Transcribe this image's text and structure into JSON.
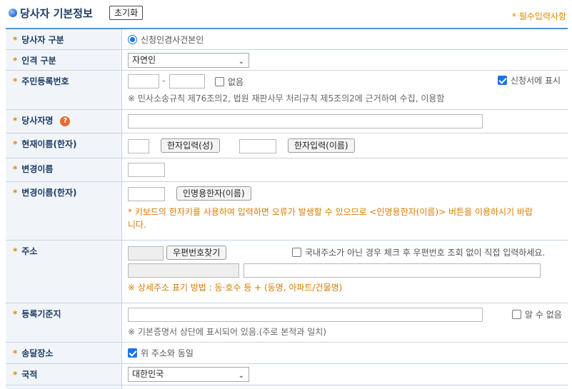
{
  "header": {
    "title": "당사자 기본정보",
    "reset_label": "초기화",
    "required_note": "* 필수입력사항"
  },
  "rows": {
    "party_type": {
      "label": "당사자 구분",
      "radio_label": "신청인겸사건본인"
    },
    "person_type": {
      "label": "인격 구분",
      "selected": "자연인"
    },
    "rrn": {
      "label": "주민등록번호",
      "dash": "-",
      "none_label": "없음",
      "display_label": "신청서에 표시",
      "note": "※ 민사소송규칙 제76조의2, 법원 재판사무 처리규칙 제5조의2에 근거하여 수집, 이용함"
    },
    "party_name": {
      "label": "당사자명",
      "help": "?"
    },
    "current_name_hanja": {
      "label": "현재이름(한자)",
      "surname_btn": "한자입력(성)",
      "name_btn": "한자입력(이름)"
    },
    "changed_name": {
      "label": "변경이름"
    },
    "changed_name_hanja": {
      "label": "변경이름(한자)",
      "btn": "인명용한자(이름)",
      "note_line1": "* 키보드의 한자키를 사용하여 입력하면 오류가 발생할 수 있으므로 <인명용한자(이름)> 버튼을 이용하시기 바랍",
      "note_line2": "니다."
    },
    "address": {
      "label": "주소",
      "postcode_btn": "우편번호찾기",
      "direct_label": "국내주소가 아닌 경우 체크 후 우편번호 조회 없이 직접 입력하세요.",
      "note": "※ 상세주소 표기 방법 : 동·호수 등 + (동명, 아파트/건물명)"
    },
    "registry_base": {
      "label": "등록기준지",
      "unknown_label": "알 수 없음",
      "note": "※ 기본증명서 상단에 표시되어 있음.(주로 본적과 일치)"
    },
    "delivery": {
      "label": "송달장소",
      "same_label": "위 주소와 동일"
    },
    "nationality": {
      "label": "국적",
      "selected": "대한민국"
    }
  },
  "colors": {
    "accent": "#1f3b63",
    "required": "#d98b00",
    "border": "#c9d3df",
    "label_bg": "#f1f5fa",
    "checkbox": "#1a73e8"
  }
}
